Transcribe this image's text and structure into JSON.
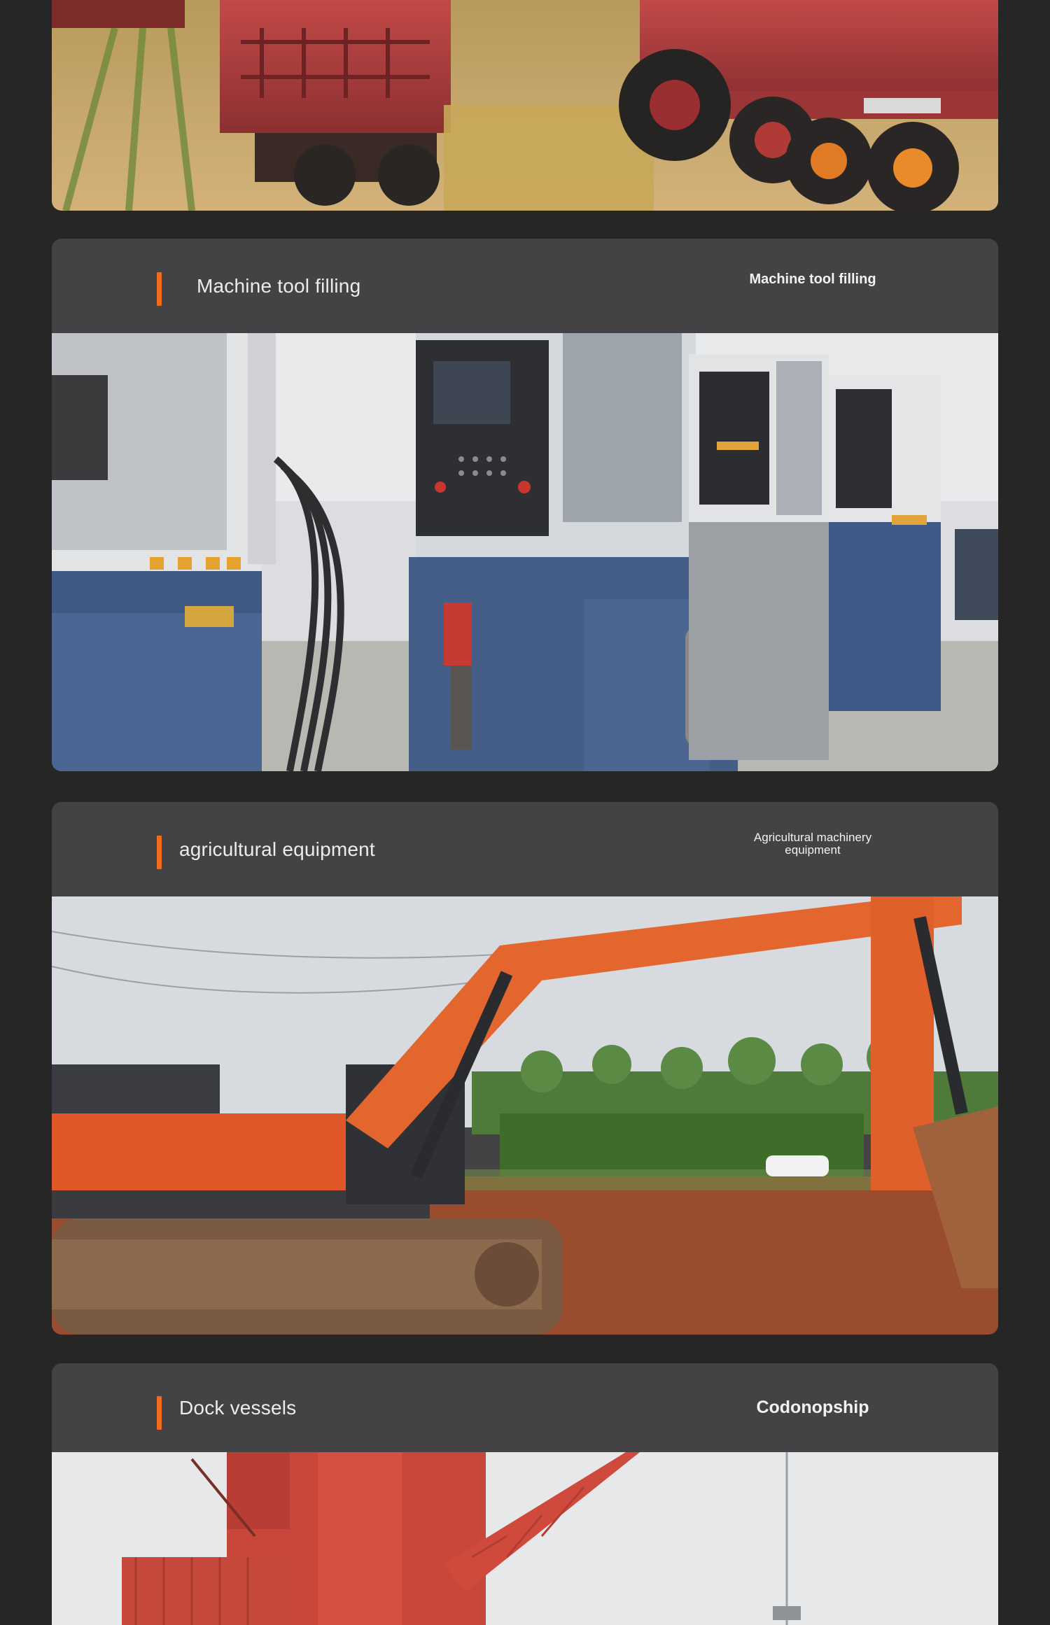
{
  "sections": [
    {
      "title": "Machine tool filling",
      "tag": "Machine tool filling",
      "image": "cnc-machine-tools-photo"
    },
    {
      "title": "agricultural equipment",
      "tag": "Agricultural machinery equipment",
      "image": "excavator-photo"
    },
    {
      "title": "Dock vessels",
      "tag": "Codonopship",
      "image": "port-crane-photo"
    }
  ],
  "top_image": "harvester-trucks-photo",
  "colors": {
    "background": "#262627",
    "panel": "#434346",
    "accent": "#f06b1d",
    "text": "#ececec"
  }
}
